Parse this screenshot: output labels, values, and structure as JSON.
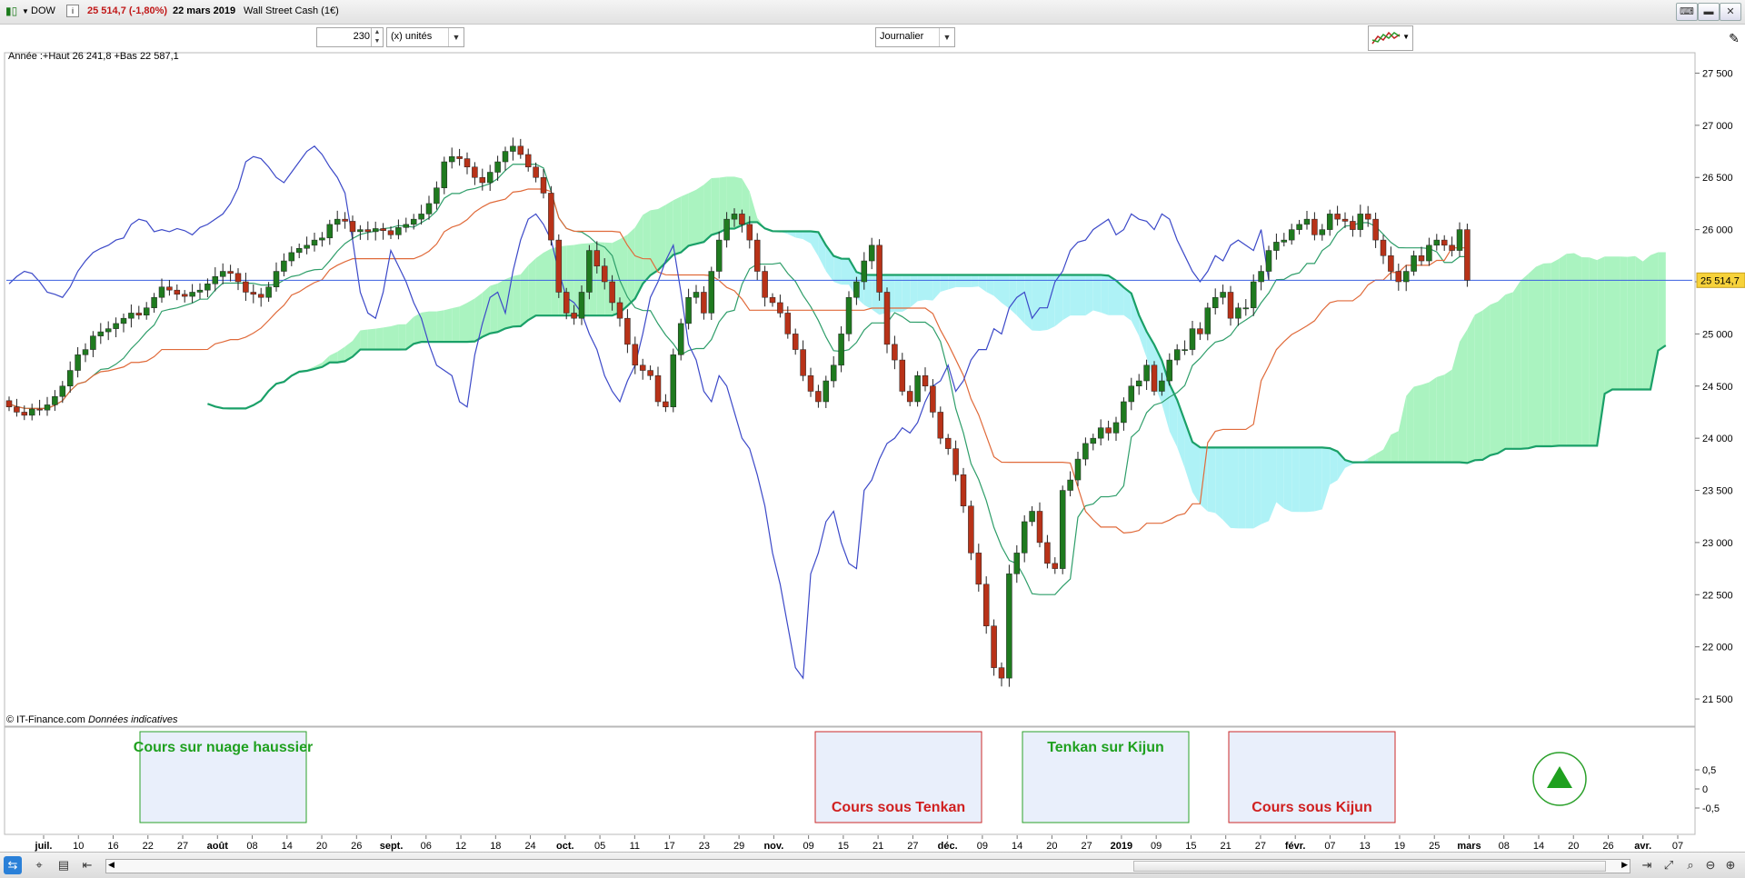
{
  "header": {
    "symbol": "DOW",
    "info_icon": "i",
    "price_change": "25 514,7 (-1,80%)",
    "date": "22 mars 2019",
    "instrument": "Wall Street Cash (1€)"
  },
  "toolbar": {
    "units_value": "230",
    "units_label": "(x) unités",
    "period_label": "Journalier"
  },
  "chart_info": {
    "range_note": "Année :+Haut 26 241,8 +Bas 22 587,1",
    "credit": "© IT-Finance.com",
    "credit_note": "Données indicatives",
    "current_price_label": "25 514,7"
  },
  "chart_data": {
    "type": "candlestick",
    "ylim": [
      21300,
      27600
    ],
    "y_ticks": [
      21500,
      22000,
      22500,
      23000,
      23500,
      24000,
      24500,
      25000,
      25500,
      26000,
      26500,
      27000,
      27500
    ],
    "y_tick_labels": [
      "21 500",
      "22 000",
      "22 500",
      "23 000",
      "23 500",
      "24 000",
      "24 500",
      "25 000",
      "25 500",
      "26 000",
      "26 500",
      "27 000",
      "27 500"
    ],
    "current_price": 25514.7,
    "x_ticks": [
      {
        "label": "juil.",
        "bold": true
      },
      {
        "label": "10",
        "bold": false
      },
      {
        "label": "16",
        "bold": false
      },
      {
        "label": "22",
        "bold": false
      },
      {
        "label": "27",
        "bold": false
      },
      {
        "label": "août",
        "bold": true
      },
      {
        "label": "08",
        "bold": false
      },
      {
        "label": "14",
        "bold": false
      },
      {
        "label": "20",
        "bold": false
      },
      {
        "label": "26",
        "bold": false
      },
      {
        "label": "sept.",
        "bold": true
      },
      {
        "label": "06",
        "bold": false
      },
      {
        "label": "12",
        "bold": false
      },
      {
        "label": "18",
        "bold": false
      },
      {
        "label": "24",
        "bold": false
      },
      {
        "label": "oct.",
        "bold": true
      },
      {
        "label": "05",
        "bold": false
      },
      {
        "label": "11",
        "bold": false
      },
      {
        "label": "17",
        "bold": false
      },
      {
        "label": "23",
        "bold": false
      },
      {
        "label": "29",
        "bold": false
      },
      {
        "label": "nov.",
        "bold": true
      },
      {
        "label": "09",
        "bold": false
      },
      {
        "label": "15",
        "bold": false
      },
      {
        "label": "21",
        "bold": false
      },
      {
        "label": "27",
        "bold": false
      },
      {
        "label": "déc.",
        "bold": true
      },
      {
        "label": "09",
        "bold": false
      },
      {
        "label": "14",
        "bold": false
      },
      {
        "label": "20",
        "bold": false
      },
      {
        "label": "27",
        "bold": false
      },
      {
        "label": "2019",
        "bold": true
      },
      {
        "label": "09",
        "bold": false
      },
      {
        "label": "15",
        "bold": false
      },
      {
        "label": "21",
        "bold": false
      },
      {
        "label": "27",
        "bold": false
      },
      {
        "label": "févr.",
        "bold": true
      },
      {
        "label": "07",
        "bold": false
      },
      {
        "label": "13",
        "bold": false
      },
      {
        "label": "19",
        "bold": false
      },
      {
        "label": "25",
        "bold": false
      },
      {
        "label": "mars",
        "bold": true
      },
      {
        "label": "08",
        "bold": false
      },
      {
        "label": "14",
        "bold": false
      },
      {
        "label": "20",
        "bold": false
      },
      {
        "label": "26",
        "bold": false
      },
      {
        "label": "avr.",
        "bold": true
      },
      {
        "label": "07",
        "bold": false
      }
    ],
    "close": [
      24300,
      24250,
      24220,
      24280,
      24270,
      24320,
      24400,
      24500,
      24650,
      24800,
      24850,
      24980,
      25020,
      25050,
      25100,
      25150,
      25200,
      25180,
      25250,
      25350,
      25450,
      25420,
      25380,
      25360,
      25400,
      25420,
      25480,
      25550,
      25600,
      25580,
      25500,
      25400,
      25380,
      25350,
      25450,
      25600,
      25700,
      25780,
      25820,
      25850,
      25900,
      25920,
      26050,
      26100,
      26080,
      25980,
      26000,
      25980,
      26010,
      25990,
      25950,
      26020,
      26050,
      26100,
      26150,
      26250,
      26400,
      26650,
      26700,
      26680,
      26600,
      26500,
      26450,
      26550,
      26650,
      26750,
      26800,
      26720,
      26600,
      26500,
      26350,
      25900,
      25400,
      25200,
      25150,
      25400,
      25800,
      25650,
      25500,
      25300,
      25150,
      24900,
      24700,
      24650,
      24600,
      24350,
      24300,
      24800,
      25100,
      25350,
      25400,
      25200,
      25600,
      25900,
      26100,
      26150,
      26050,
      25900,
      25600,
      25350,
      25300,
      25200,
      25000,
      24850,
      24600,
      24450,
      24350,
      24550,
      24700,
      25000,
      25350,
      25500,
      25700,
      25850,
      25400,
      24900,
      24750,
      24450,
      24350,
      24600,
      24500,
      24250,
      24000,
      23900,
      23650,
      23350,
      22900,
      22600,
      22200,
      21800,
      21700,
      22700,
      22900,
      23200,
      23300,
      23000,
      22800,
      22750,
      23500,
      23600,
      23800,
      23950,
      24000,
      24100,
      24050,
      24150,
      24350,
      24500,
      24550,
      24700,
      24450,
      24550,
      24750,
      24850,
      24850,
      25050,
      25000,
      25250,
      25350,
      25400,
      25150,
      25250,
      25250,
      25500,
      25600,
      25800,
      25880,
      25900,
      26000,
      26050,
      26100,
      25950,
      26000,
      26150,
      26100,
      26080,
      26000,
      26150,
      26100,
      25900,
      25750,
      25600,
      25500,
      25600,
      25750,
      25700,
      25850,
      25900,
      25850,
      25800,
      26000,
      25514.7
    ],
    "series": [
      {
        "name": "Tenkan"
      },
      {
        "name": "Kijun"
      },
      {
        "name": "Chikou"
      },
      {
        "name": "Senkou A"
      },
      {
        "name": "Senkou B"
      }
    ],
    "colors": {
      "up": "#1f7a1f",
      "down": "#b83218",
      "tenkan": "#2f9e6a",
      "kijun": "#e06a3a",
      "chikou": "#3c49c8",
      "senkou_b": "#1aa068",
      "cloud_up": "#aaf3c0",
      "cloud_down": "#aef2f6",
      "price_line": "#3a5fe0"
    }
  },
  "signals": [
    {
      "label": "Cours sur nuage haussier",
      "type": "bullish"
    },
    {
      "label": "Cours sous Tenkan",
      "type": "bearish"
    },
    {
      "label": "Tenkan sur Kijun",
      "type": "bullish"
    },
    {
      "label": "Cours sous Kijun",
      "type": "bearish"
    }
  ],
  "indicator_axis": {
    "ticks": [
      "0,5",
      "0",
      "-0,5"
    ]
  },
  "bottom_icons": [
    "share-icon",
    "crosshair-icon",
    "table-icon",
    "scroll-start-icon",
    "scroll-end-icon",
    "auto-scale-icon",
    "zoom-icon",
    "zoom-out-icon",
    "zoom-in-icon"
  ]
}
